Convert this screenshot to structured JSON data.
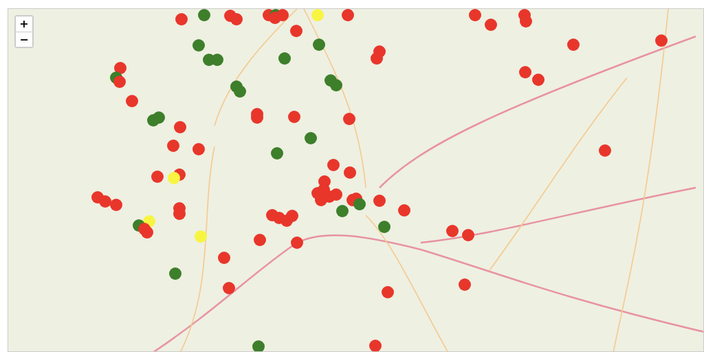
{
  "zoom_controls": [
    {
      "label": "+"
    },
    {
      "label": "−"
    }
  ],
  "markers": [
    {
      "color": "#e8362b"
    },
    {
      "color": "#3d7f2a"
    },
    {
      "color": "#e8362b"
    },
    {
      "color": "#e8362b"
    },
    {
      "color": "#e8362b"
    },
    {
      "color": "#3d7f2a"
    },
    {
      "color": "#e8362b"
    },
    {
      "color": "#e8362b"
    },
    {
      "color": "#f7f542"
    },
    {
      "color": "#e8362b"
    },
    {
      "color": "#e8362b"
    },
    {
      "color": "#3d7f2a"
    },
    {
      "color": "#3d7f2a"
    },
    {
      "color": "#e8362b"
    },
    {
      "color": "#e8362b"
    },
    {
      "color": "#e8362b"
    },
    {
      "color": "#e8362b"
    },
    {
      "color": "#e8362b"
    },
    {
      "color": "#e8362b"
    },
    {
      "color": "#e8362b"
    },
    {
      "color": "#e8362b"
    },
    {
      "color": "#e8362b"
    },
    {
      "color": "#e8362b"
    },
    {
      "color": "#e8362b"
    },
    {
      "color": "#3d7f2a"
    },
    {
      "color": "#3d7f2a"
    },
    {
      "color": "#3d7f2a"
    },
    {
      "color": "#e8362b"
    },
    {
      "color": "#3d7f2a"
    },
    {
      "color": "#e8362b"
    },
    {
      "color": "#e8362b"
    },
    {
      "color": "#3d7f2a"
    },
    {
      "color": "#3d7f2a"
    },
    {
      "color": "#3d7f2a"
    },
    {
      "color": "#3d7f2a"
    },
    {
      "color": "#e8362b"
    },
    {
      "color": "#e8362b"
    },
    {
      "color": "#e8362b"
    },
    {
      "color": "#e8362b"
    },
    {
      "color": "#3d7f2a"
    },
    {
      "color": "#3d7f2a"
    },
    {
      "color": "#e8362b"
    },
    {
      "color": "#e8362b"
    },
    {
      "color": "#e8362b"
    },
    {
      "color": "#3d7f2a"
    },
    {
      "color": "#3d7f2a"
    },
    {
      "color": "#e8362b"
    },
    {
      "color": "#e8362b"
    },
    {
      "color": "#e8362b"
    },
    {
      "color": "#e8362b"
    },
    {
      "color": "#e8362b"
    },
    {
      "color": "#f7f542"
    },
    {
      "color": "#e8362b"
    },
    {
      "color": "#e8362b"
    },
    {
      "color": "#e8362b"
    },
    {
      "color": "#e8362b"
    },
    {
      "color": "#e8362b"
    },
    {
      "color": "#e8362b"
    },
    {
      "color": "#e8362b"
    },
    {
      "color": "#e8362b"
    },
    {
      "color": "#e8362b"
    },
    {
      "color": "#e8362b"
    },
    {
      "color": "#3d7f2a"
    },
    {
      "color": "#e8362b"
    },
    {
      "color": "#e8362b"
    },
    {
      "color": "#3d7f2a"
    },
    {
      "color": "#e8362b"
    },
    {
      "color": "#e8362b"
    },
    {
      "color": "#e8362b"
    },
    {
      "color": "#e8362b"
    },
    {
      "color": "#e8362b"
    },
    {
      "color": "#e8362b"
    },
    {
      "color": "#f7f542"
    },
    {
      "color": "#3d7f2a"
    },
    {
      "color": "#e8362b"
    },
    {
      "color": "#e8362b"
    },
    {
      "color": "#3d7f2a"
    },
    {
      "color": "#e8362b"
    },
    {
      "color": "#e8362b"
    },
    {
      "color": "#f7f542"
    },
    {
      "color": "#e8362b"
    },
    {
      "color": "#e8362b"
    },
    {
      "color": "#e8362b"
    },
    {
      "color": "#3d7f2a"
    },
    {
      "color": "#e8362b"
    },
    {
      "color": "#e8362b"
    },
    {
      "color": "#e8362b"
    },
    {
      "color": "#e8362b"
    },
    {
      "color": "#3d7f2a"
    }
  ]
}
